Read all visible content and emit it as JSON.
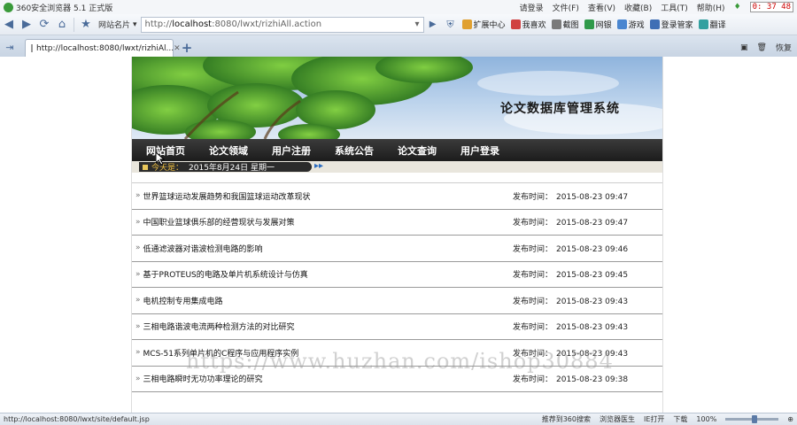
{
  "browser": {
    "window_title": "360安全浏览器 5.1 正式版",
    "menus": [
      "请登录",
      "文件(F)",
      "查看(V)",
      "收藏(B)",
      "工具(T)",
      "帮助(H)"
    ],
    "clock": "0: 37 48",
    "nav_dropdown": "网站名片",
    "address_prefix": "http://",
    "address_host": "localhost",
    "address_rest": ":8080/lwxt/rizhiAll.action",
    "toolbar_items": [
      "扩展中心",
      "我喜欢",
      "截图",
      "网银",
      "游戏",
      "登录管家",
      "翻译"
    ],
    "tab_title": "http://localhost:8080/lwxt/rizhiAl...",
    "tab_right": [
      "恢复"
    ],
    "status_url": "http://localhost:8080/lwxt/site/default.jsp",
    "status_items": [
      "推荐到360搜索",
      "浏览器医生",
      "IE打开",
      "下载"
    ],
    "zoom": "100%",
    "zoom_level": 0.55
  },
  "site": {
    "title": "论文数据库管理系统",
    "nav": [
      "网站首页",
      "论文领域",
      "用户注册",
      "系统公告",
      "论文查询",
      "用户登录"
    ],
    "today_label": "今天是：",
    "today_value": "2015年8月24日 星期一",
    "publish_label": "发布时间：",
    "articles": [
      {
        "title": "世界篮球运动发展趋势和我国篮球运动改革现状",
        "time": "2015-08-23 09:47"
      },
      {
        "title": "中国职业篮球俱乐部的经营现状与发展对策",
        "time": "2015-08-23 09:47"
      },
      {
        "title": "低通滤波器对谐波检测电路的影响",
        "time": "2015-08-23 09:46"
      },
      {
        "title": "基于PROTEUS的电路及单片机系统设计与仿真",
        "time": "2015-08-23 09:45"
      },
      {
        "title": "电机控制专用集成电路",
        "time": "2015-08-23 09:43"
      },
      {
        "title": "三相电路谐波电流两种检测方法的对比研究",
        "time": "2015-08-23 09:43"
      },
      {
        "title": "MCS-51系列单片机的C程序与应用程序实例",
        "time": "2015-08-23 09:43"
      },
      {
        "title": "三相电路瞬时无功功率理论的研究",
        "time": "2015-08-23 09:38"
      }
    ]
  },
  "watermark": "https://www.huzhan.com/ishop30884",
  "colors": {
    "nav_bg": "#2a2a2a",
    "banner_sky": "#bcd3ec",
    "datebar_bg": "#e9e6dd",
    "date_label": "#f0c040"
  }
}
